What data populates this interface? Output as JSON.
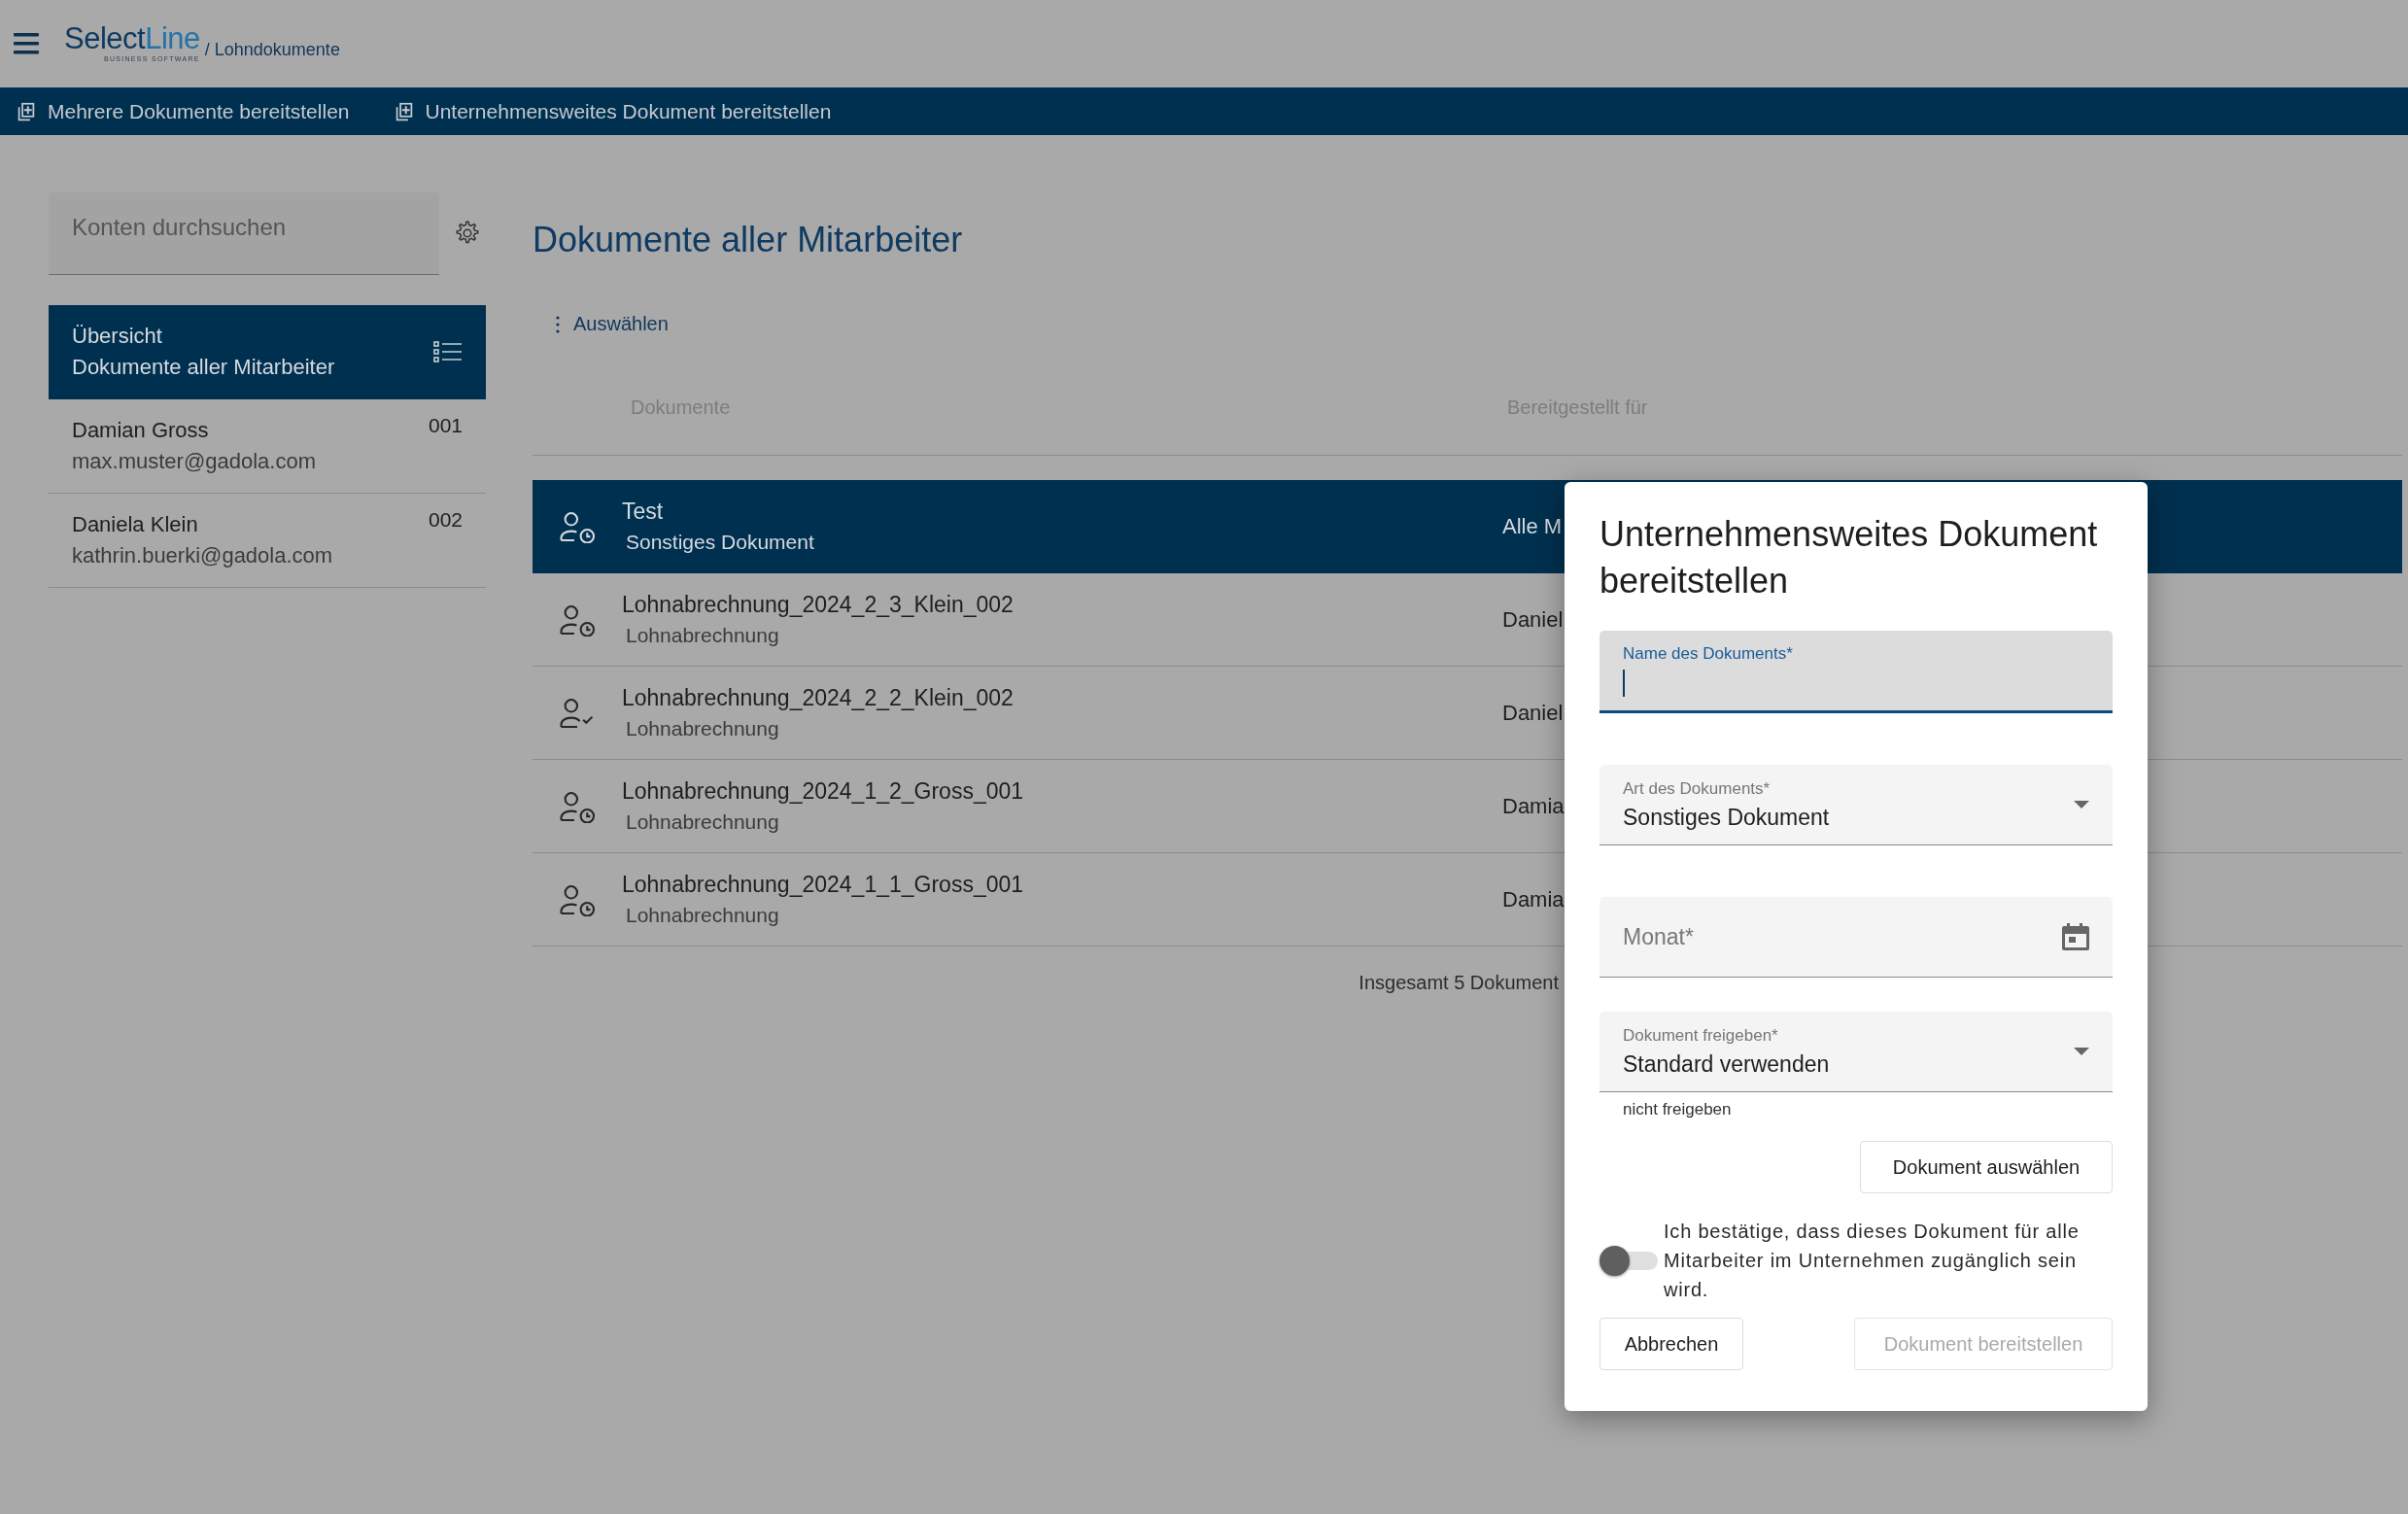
{
  "header": {
    "logo_text": "SelectLine",
    "logo_tagline": "BUSINESS SOFTWARE",
    "breadcrumb": "/ Lohndokumente"
  },
  "toolbar": [
    {
      "label": "Mehrere Dokumente bereitstellen"
    },
    {
      "label": "Unternehmensweites Dokument bereitstellen"
    }
  ],
  "sidebar": {
    "search": {
      "placeholder": "Konten durchsuchen"
    },
    "items": [
      {
        "kind": "overview",
        "title": "Übersicht",
        "subtitle": "Dokumente aller Mitarbeiter",
        "selected": true
      },
      {
        "kind": "employee",
        "title": "Damian Gross",
        "subtitle": "max.muster@gadola.com",
        "number": "001",
        "selected": false
      },
      {
        "kind": "employee",
        "title": "Daniela Klein",
        "subtitle": "kathrin.buerki@gadola.com",
        "number": "002",
        "selected": false
      }
    ]
  },
  "main": {
    "title": "Dokumente aller Mitarbeiter",
    "select_menu": "Auswählen",
    "table": {
      "columns": [
        "Dokumente",
        "Bereitgestellt für"
      ],
      "rows": [
        {
          "kind": "pending",
          "name": "Test",
          "type": "Sonstiges Dokument",
          "recipient": "Alle M",
          "selected": true
        },
        {
          "kind": "pending",
          "name": "Lohnabrechnung_2024_2_3_Klein_002",
          "type": "Lohnabrechnung",
          "recipient": "Daniel",
          "selected": false
        },
        {
          "kind": "confirmed",
          "name": "Lohnabrechnung_2024_2_2_Klein_002",
          "type": "Lohnabrechnung",
          "recipient": "Daniel",
          "selected": false
        },
        {
          "kind": "pending",
          "name": "Lohnabrechnung_2024_1_2_Gross_001",
          "type": "Lohnabrechnung",
          "recipient": "Damia",
          "selected": false
        },
        {
          "kind": "pending",
          "name": "Lohnabrechnung_2024_1_1_Gross_001",
          "type": "Lohnabrechnung",
          "recipient": "Damia",
          "selected": false
        }
      ],
      "footer": "Insgesamt 5 Dokument"
    }
  },
  "dialog": {
    "title": "Unternehmensweites Dokument bereitstellen",
    "fields": [
      {
        "kind": "text",
        "label": "Name des Dokuments*",
        "focused": true
      },
      {
        "kind": "select",
        "label": "Art des Dokuments*",
        "value": "Sonstiges Dokument",
        "focused": false
      },
      {
        "kind": "date",
        "placeholder": "Monat*",
        "focused": false
      },
      {
        "kind": "select",
        "label": "Dokument freigeben*",
        "value": "Standard verwenden",
        "hint": "nicht freigeben",
        "focused": false
      }
    ],
    "choose_button": {
      "label": "Dokument auswählen",
      "disabled": false
    },
    "confirm_toggle": {
      "label": "Ich bestätige, dass dieses Dokument für alle Mitarbeiter im Unternehmen zugänglich sein wird.",
      "on": false
    },
    "cancel_button": {
      "label": "Abbrechen",
      "disabled": false
    },
    "submit_button": {
      "label": "Dokument bereitstellen",
      "disabled": true
    }
  }
}
